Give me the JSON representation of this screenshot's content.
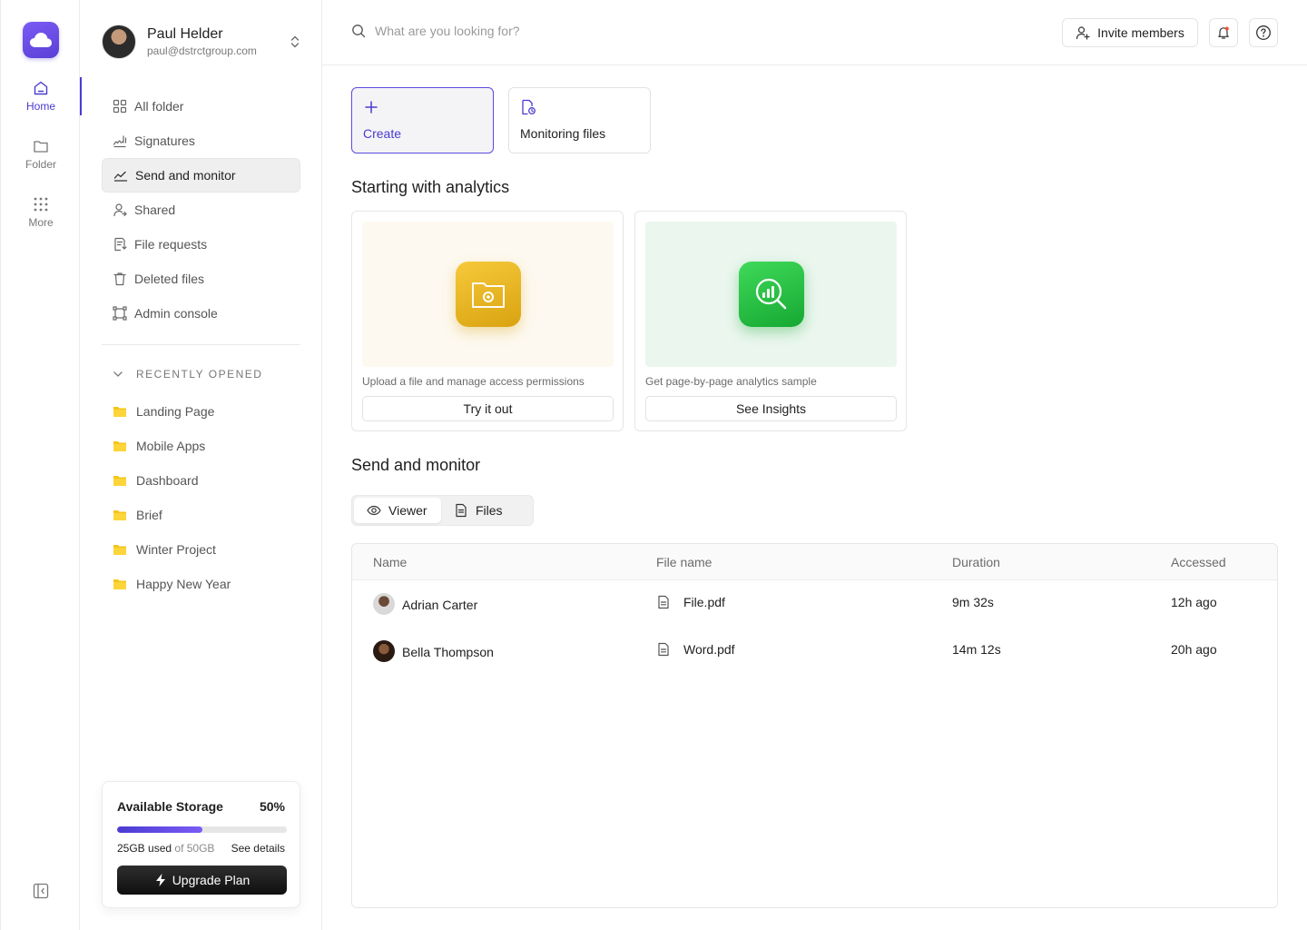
{
  "user": {
    "name": "Paul Helder",
    "email": "paul@dstrctgroup.com"
  },
  "rail": {
    "items": [
      {
        "label": "Home"
      },
      {
        "label": "Folder"
      },
      {
        "label": "More"
      }
    ]
  },
  "nav": {
    "items": [
      {
        "label": "All folder"
      },
      {
        "label": "Signatures"
      },
      {
        "label": "Send and monitor"
      },
      {
        "label": "Shared"
      },
      {
        "label": "File requests"
      },
      {
        "label": "Deleted files"
      },
      {
        "label": "Admin console"
      }
    ]
  },
  "recent": {
    "heading": "RECENTLY OPENED",
    "items": [
      {
        "label": "Landing Page"
      },
      {
        "label": "Mobile Apps"
      },
      {
        "label": "Dashboard"
      },
      {
        "label": "Brief"
      },
      {
        "label": "Winter Project"
      },
      {
        "label": "Happy New Year"
      }
    ]
  },
  "storage": {
    "title": "Available Storage",
    "percent_label": "50%",
    "fill_percent": 50,
    "used": "25GB used",
    "total": "of 50GB",
    "details": "See details",
    "upgrade": "Upgrade Plan"
  },
  "header": {
    "search_placeholder": "What are you looking for?",
    "invite": "Invite members"
  },
  "quick": {
    "create": "Create",
    "monitoring": "Monitoring files"
  },
  "analytics": {
    "title": "Starting with analytics",
    "cards": [
      {
        "desc": "Upload a file and manage access permissions",
        "button": "Try it out"
      },
      {
        "desc": "Get page-by-page analytics sample",
        "button": "See Insights"
      }
    ]
  },
  "monitor": {
    "title": "Send and monitor",
    "tabs": [
      {
        "label": "Viewer"
      },
      {
        "label": "Files"
      }
    ]
  },
  "table": {
    "headers": {
      "name": "Name",
      "file": "File name",
      "duration": "Duration",
      "accessed": "Accessed"
    },
    "rows": [
      {
        "name": "Adrian Carter",
        "file": "File.pdf",
        "duration": "9m 32s",
        "accessed": "12h ago"
      },
      {
        "name": "Bella Thompson",
        "file": "Word.pdf",
        "duration": "14m 12s",
        "accessed": "20h ago"
      }
    ]
  },
  "colors": {
    "accent": "#4a3bd1",
    "folder": "#f5c518",
    "card_yellow_bg": "#fdf9f0",
    "card_green_bg": "#eaf6ee"
  }
}
